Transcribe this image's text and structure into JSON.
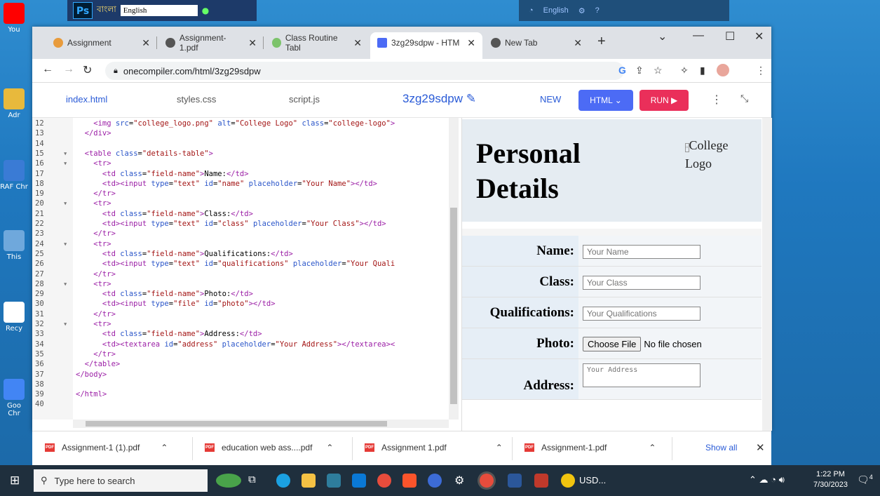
{
  "system_top": {
    "ps_label": "Ps",
    "lang_app": "বাংলা",
    "lang_value": "English",
    "ime_label": "English"
  },
  "desktop_icons": [
    {
      "label": "You",
      "color": "#ff0000"
    },
    {
      "label": "Adr",
      "color": "#e8b93c"
    },
    {
      "label": "RAF Chr",
      "color": "#3a7bd5"
    },
    {
      "label": "This",
      "color": "#6fa8dc"
    },
    {
      "label": "Recy",
      "color": "#ffffff"
    },
    {
      "label": "Goo Chr",
      "color": "#4285f4"
    }
  ],
  "browser": {
    "tabs": [
      {
        "label": "Assignment",
        "icon_color": "#e89b3c"
      },
      {
        "label": "Assignment-1.pdf",
        "icon_color": "#555555"
      },
      {
        "label": "Class Routine Tabl",
        "icon_color": "#7cc36b"
      },
      {
        "label": "3zg29sdpw - HTM",
        "icon_color": "#4c6bf5"
      },
      {
        "label": "New Tab",
        "icon_color": "#555555"
      }
    ],
    "url": "onecompiler.com/html/3zg29sdpw"
  },
  "editor": {
    "file_tabs": [
      "index.html",
      "styles.css",
      "script.js"
    ],
    "project": "3zg29sdpw",
    "new_label": "NEW",
    "html_label": "HTML",
    "run_label": "RUN",
    "lines": [
      {
        "n": "12",
        "f": "",
        "code": [
          [
            "tg",
            "    <img "
          ],
          [
            "at",
            "src"
          ],
          [
            "tx",
            "="
          ],
          [
            "st",
            "\"college_logo.png\""
          ],
          [
            "tx",
            " "
          ],
          [
            "at",
            "alt"
          ],
          [
            "tx",
            "="
          ],
          [
            "st",
            "\"College Logo\""
          ],
          [
            "tx",
            " "
          ],
          [
            "at",
            "class"
          ],
          [
            "tx",
            "="
          ],
          [
            "st",
            "\"college-logo\""
          ],
          [
            "tg",
            ">"
          ]
        ]
      },
      {
        "n": "13",
        "f": "",
        "code": [
          [
            "tg",
            "  </div>"
          ]
        ]
      },
      {
        "n": "14",
        "f": "",
        "code": []
      },
      {
        "n": "15",
        "f": "▾",
        "code": [
          [
            "tg",
            "  <table "
          ],
          [
            "at",
            "class"
          ],
          [
            "tx",
            "="
          ],
          [
            "st",
            "\"details-table\""
          ],
          [
            "tg",
            ">"
          ]
        ]
      },
      {
        "n": "16",
        "f": "▾",
        "code": [
          [
            "tg",
            "    <tr>"
          ]
        ]
      },
      {
        "n": "17",
        "f": "",
        "code": [
          [
            "tg",
            "      <td "
          ],
          [
            "at",
            "class"
          ],
          [
            "tx",
            "="
          ],
          [
            "st",
            "\"field-name\""
          ],
          [
            "tg",
            ">"
          ],
          [
            "tx",
            "Name:"
          ],
          [
            "tg",
            "</td>"
          ]
        ]
      },
      {
        "n": "18",
        "f": "",
        "code": [
          [
            "tg",
            "      <td><input "
          ],
          [
            "at",
            "type"
          ],
          [
            "tx",
            "="
          ],
          [
            "st",
            "\"text\""
          ],
          [
            "tx",
            " "
          ],
          [
            "at",
            "id"
          ],
          [
            "tx",
            "="
          ],
          [
            "st",
            "\"name\""
          ],
          [
            "tx",
            " "
          ],
          [
            "at",
            "placeholder"
          ],
          [
            "tx",
            "="
          ],
          [
            "st",
            "\"Your Name\""
          ],
          [
            "tg",
            "></td>"
          ]
        ]
      },
      {
        "n": "19",
        "f": "",
        "code": [
          [
            "tg",
            "    </tr>"
          ]
        ]
      },
      {
        "n": "20",
        "f": "▾",
        "code": [
          [
            "tg",
            "    <tr>"
          ]
        ]
      },
      {
        "n": "21",
        "f": "",
        "code": [
          [
            "tg",
            "      <td "
          ],
          [
            "at",
            "class"
          ],
          [
            "tx",
            "="
          ],
          [
            "st",
            "\"field-name\""
          ],
          [
            "tg",
            ">"
          ],
          [
            "tx",
            "Class:"
          ],
          [
            "tg",
            "</td>"
          ]
        ]
      },
      {
        "n": "22",
        "f": "",
        "code": [
          [
            "tg",
            "      <td><input "
          ],
          [
            "at",
            "type"
          ],
          [
            "tx",
            "="
          ],
          [
            "st",
            "\"text\""
          ],
          [
            "tx",
            " "
          ],
          [
            "at",
            "id"
          ],
          [
            "tx",
            "="
          ],
          [
            "st",
            "\"class\""
          ],
          [
            "tx",
            " "
          ],
          [
            "at",
            "placeholder"
          ],
          [
            "tx",
            "="
          ],
          [
            "st",
            "\"Your Class\""
          ],
          [
            "tg",
            "></td>"
          ]
        ]
      },
      {
        "n": "23",
        "f": "",
        "code": [
          [
            "tg",
            "    </tr>"
          ]
        ]
      },
      {
        "n": "24",
        "f": "▾",
        "code": [
          [
            "tg",
            "    <tr>"
          ]
        ]
      },
      {
        "n": "25",
        "f": "",
        "code": [
          [
            "tg",
            "      <td "
          ],
          [
            "at",
            "class"
          ],
          [
            "tx",
            "="
          ],
          [
            "st",
            "\"field-name\""
          ],
          [
            "tg",
            ">"
          ],
          [
            "tx",
            "Qualifications:"
          ],
          [
            "tg",
            "</td>"
          ]
        ]
      },
      {
        "n": "26",
        "f": "",
        "code": [
          [
            "tg",
            "      <td><input "
          ],
          [
            "at",
            "type"
          ],
          [
            "tx",
            "="
          ],
          [
            "st",
            "\"text\""
          ],
          [
            "tx",
            " "
          ],
          [
            "at",
            "id"
          ],
          [
            "tx",
            "="
          ],
          [
            "st",
            "\"qualifications\""
          ],
          [
            "tx",
            " "
          ],
          [
            "at",
            "placeholder"
          ],
          [
            "tx",
            "="
          ],
          [
            "st",
            "\"Your Quali"
          ]
        ]
      },
      {
        "n": "27",
        "f": "",
        "code": [
          [
            "tg",
            "    </tr>"
          ]
        ]
      },
      {
        "n": "28",
        "f": "▾",
        "code": [
          [
            "tg",
            "    <tr>"
          ]
        ]
      },
      {
        "n": "29",
        "f": "",
        "code": [
          [
            "tg",
            "      <td "
          ],
          [
            "at",
            "class"
          ],
          [
            "tx",
            "="
          ],
          [
            "st",
            "\"field-name\""
          ],
          [
            "tg",
            ">"
          ],
          [
            "tx",
            "Photo:"
          ],
          [
            "tg",
            "</td>"
          ]
        ]
      },
      {
        "n": "30",
        "f": "",
        "code": [
          [
            "tg",
            "      <td><input "
          ],
          [
            "at",
            "type"
          ],
          [
            "tx",
            "="
          ],
          [
            "st",
            "\"file\""
          ],
          [
            "tx",
            " "
          ],
          [
            "at",
            "id"
          ],
          [
            "tx",
            "="
          ],
          [
            "st",
            "\"photo\""
          ],
          [
            "tg",
            "></td>"
          ]
        ]
      },
      {
        "n": "31",
        "f": "",
        "code": [
          [
            "tg",
            "    </tr>"
          ]
        ]
      },
      {
        "n": "32",
        "f": "▾",
        "code": [
          [
            "tg",
            "    <tr>"
          ]
        ]
      },
      {
        "n": "33",
        "f": "",
        "code": [
          [
            "tg",
            "      <td "
          ],
          [
            "at",
            "class"
          ],
          [
            "tx",
            "="
          ],
          [
            "st",
            "\"field-name\""
          ],
          [
            "tg",
            ">"
          ],
          [
            "tx",
            "Address:"
          ],
          [
            "tg",
            "</td>"
          ]
        ]
      },
      {
        "n": "34",
        "f": "",
        "code": [
          [
            "tg",
            "      <td><textarea "
          ],
          [
            "at",
            "id"
          ],
          [
            "tx",
            "="
          ],
          [
            "st",
            "\"address\""
          ],
          [
            "tx",
            " "
          ],
          [
            "at",
            "placeholder"
          ],
          [
            "tx",
            "="
          ],
          [
            "st",
            "\"Your Address\""
          ],
          [
            "tg",
            "></textarea><"
          ]
        ]
      },
      {
        "n": "35",
        "f": "",
        "code": [
          [
            "tg",
            "    </tr>"
          ]
        ]
      },
      {
        "n": "36",
        "f": "",
        "code": [
          [
            "tg",
            "  </table>"
          ]
        ]
      },
      {
        "n": "37",
        "f": "",
        "code": [
          [
            "tg",
            "</body>"
          ]
        ]
      },
      {
        "n": "38",
        "f": "",
        "code": []
      },
      {
        "n": "39",
        "f": "",
        "code": [
          [
            "tg",
            "</html>"
          ]
        ]
      },
      {
        "n": "40",
        "f": "",
        "code": []
      }
    ]
  },
  "preview": {
    "title_line1": "Personal",
    "title_line2": "Details",
    "logo_alt": "College Logo",
    "fields": [
      {
        "label": "Name:",
        "placeholder": "Your Name"
      },
      {
        "label": "Class:",
        "placeholder": "Your Class"
      },
      {
        "label": "Qualifications:",
        "placeholder": "Your Qualifications"
      },
      {
        "label": "Photo:",
        "button": "Choose File",
        "status": "No file chosen"
      },
      {
        "label": "Address:",
        "placeholder": "Your Address"
      }
    ]
  },
  "downloads": {
    "items": [
      "Assignment-1 (1).pdf",
      "education web ass....pdf",
      "Assignment 1.pdf",
      "Assignment-1.pdf"
    ],
    "show_all": "Show all"
  },
  "taskbar": {
    "search_placeholder": "Type here to search",
    "currency": "USD...",
    "time": "1:22 PM",
    "date": "7/30/2023",
    "notif_count": "4"
  }
}
